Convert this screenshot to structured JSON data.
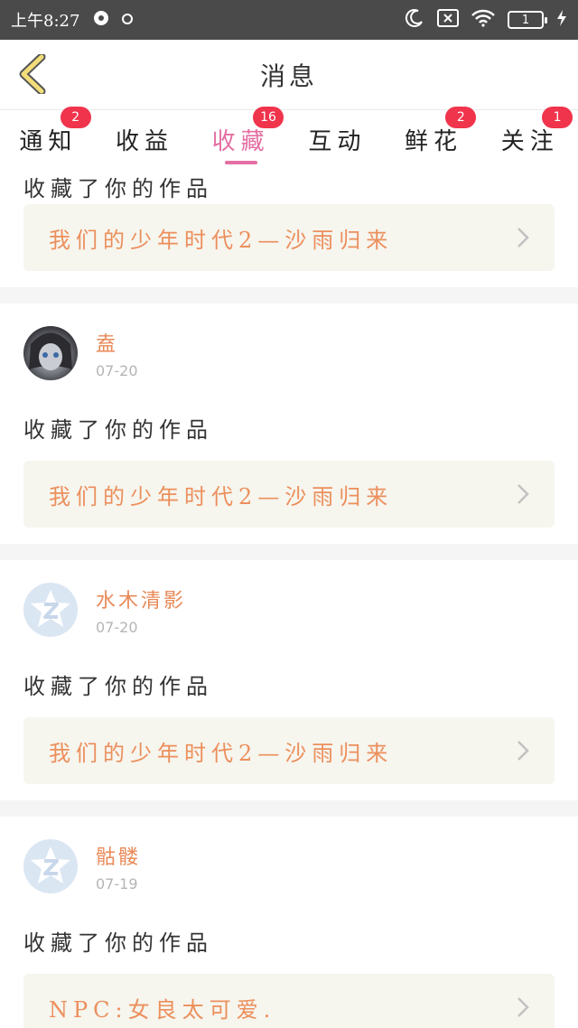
{
  "status": {
    "time": "上午8:27",
    "battery": "1"
  },
  "header": {
    "title": "消息"
  },
  "tabs": [
    {
      "label": "通知",
      "badge": "2"
    },
    {
      "label": "收益",
      "badge": ""
    },
    {
      "label": "收藏",
      "badge": "16"
    },
    {
      "label": "互动",
      "badge": ""
    },
    {
      "label": "鲜花",
      "badge": "2"
    },
    {
      "label": "关注",
      "badge": "1"
    }
  ],
  "active_tab": "收藏",
  "notifications": [
    {
      "user": "",
      "date": "",
      "action": "收藏了你的作品",
      "work": "我们的少年时代2—沙雨归来"
    },
    {
      "user": "盍",
      "date": "07-20",
      "action": "收藏了你的作品",
      "work": "我们的少年时代2—沙雨归来"
    },
    {
      "user": "水木清影",
      "date": "07-20",
      "action": "收藏了你的作品",
      "work": "我们的少年时代2—沙雨归来"
    },
    {
      "user": "骷髅",
      "date": "07-19",
      "action": "收藏了你的作品",
      "work": "NPC:女良太可爱."
    }
  ],
  "colors": {
    "accent": "#e46fa3",
    "badge": "#f0344c",
    "username": "#e88a58",
    "work_title": "#ec8f5c",
    "back_arrow": "#f2dd7a"
  }
}
